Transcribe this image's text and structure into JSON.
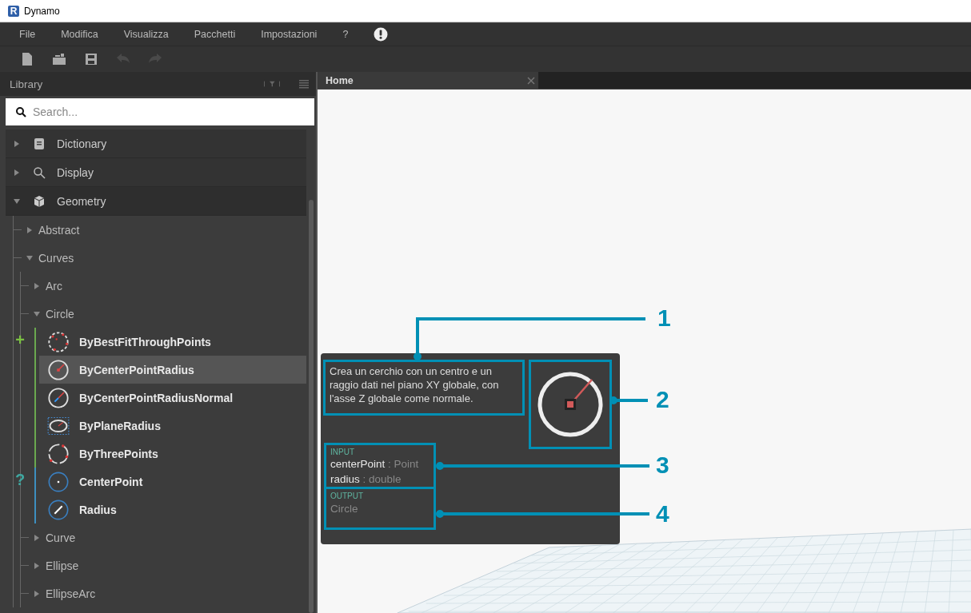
{
  "window": {
    "icon_letter": "R",
    "title": "Dynamo"
  },
  "menu": [
    {
      "label": "File"
    },
    {
      "label": "Modifica"
    },
    {
      "label": "Visualizza"
    },
    {
      "label": "Pacchetti"
    },
    {
      "label": "Impostazioni"
    },
    {
      "label": "?"
    }
  ],
  "toolbar": [
    {
      "kind": "new",
      "disabled": false
    },
    {
      "kind": "open",
      "disabled": false
    },
    {
      "kind": "save",
      "disabled": false
    },
    {
      "kind": "undo",
      "disabled": true
    },
    {
      "kind": "redo",
      "disabled": true
    }
  ],
  "library": {
    "title": "Library",
    "search": {
      "placeholder": "Search..."
    },
    "categories": [
      {
        "label": "Dictionary",
        "kind": "dictionary",
        "expanded": false
      },
      {
        "label": "Display",
        "kind": "display",
        "expanded": false
      },
      {
        "label": "Geometry",
        "kind": "geometry",
        "expanded": true,
        "children": [
          {
            "label": "Abstract",
            "expanded": false
          },
          {
            "label": "Curves",
            "expanded": true,
            "children": [
              {
                "label": "Arc",
                "expanded": false
              },
              {
                "label": "Circle",
                "expanded": true,
                "groups": [
                  {
                    "kind": "create",
                    "symbol": "+",
                    "members": [
                      {
                        "label": "ByBestFitThroughPoints",
                        "kind": "bestfit",
                        "selected": false
                      },
                      {
                        "label": "ByCenterPointRadius",
                        "kind": "centerradius",
                        "selected": true
                      },
                      {
                        "label": "ByCenterPointRadiusNormal",
                        "kind": "normal",
                        "selected": false
                      },
                      {
                        "label": "ByPlaneRadius",
                        "kind": "plane",
                        "selected": false
                      },
                      {
                        "label": "ByThreePoints",
                        "kind": "threepoints",
                        "selected": false
                      }
                    ]
                  },
                  {
                    "kind": "query",
                    "symbol": "?",
                    "members": [
                      {
                        "label": "CenterPoint",
                        "kind": "centerpoint",
                        "selected": false
                      },
                      {
                        "label": "Radius",
                        "kind": "radius",
                        "selected": false
                      }
                    ]
                  }
                ]
              },
              {
                "label": "Curve",
                "expanded": false
              },
              {
                "label": "Ellipse",
                "expanded": false
              },
              {
                "label": "EllipseArc",
                "expanded": false
              }
            ]
          }
        ]
      }
    ]
  },
  "tabs": [
    {
      "label": "Home",
      "selected": true
    }
  ],
  "tooltip": {
    "description": "Crea un cerchio con un centro e un raggio dati nel piano XY globale, con l'asse Z globale come normale.",
    "input": {
      "heading": "INPUT",
      "params": [
        {
          "name": "centerPoint",
          "type": ": Point"
        },
        {
          "name": "radius",
          "type": ": double"
        }
      ]
    },
    "output": {
      "heading": "OUTPUT",
      "value": "Circle"
    }
  },
  "callouts": [
    "1",
    "2",
    "3",
    "4"
  ]
}
